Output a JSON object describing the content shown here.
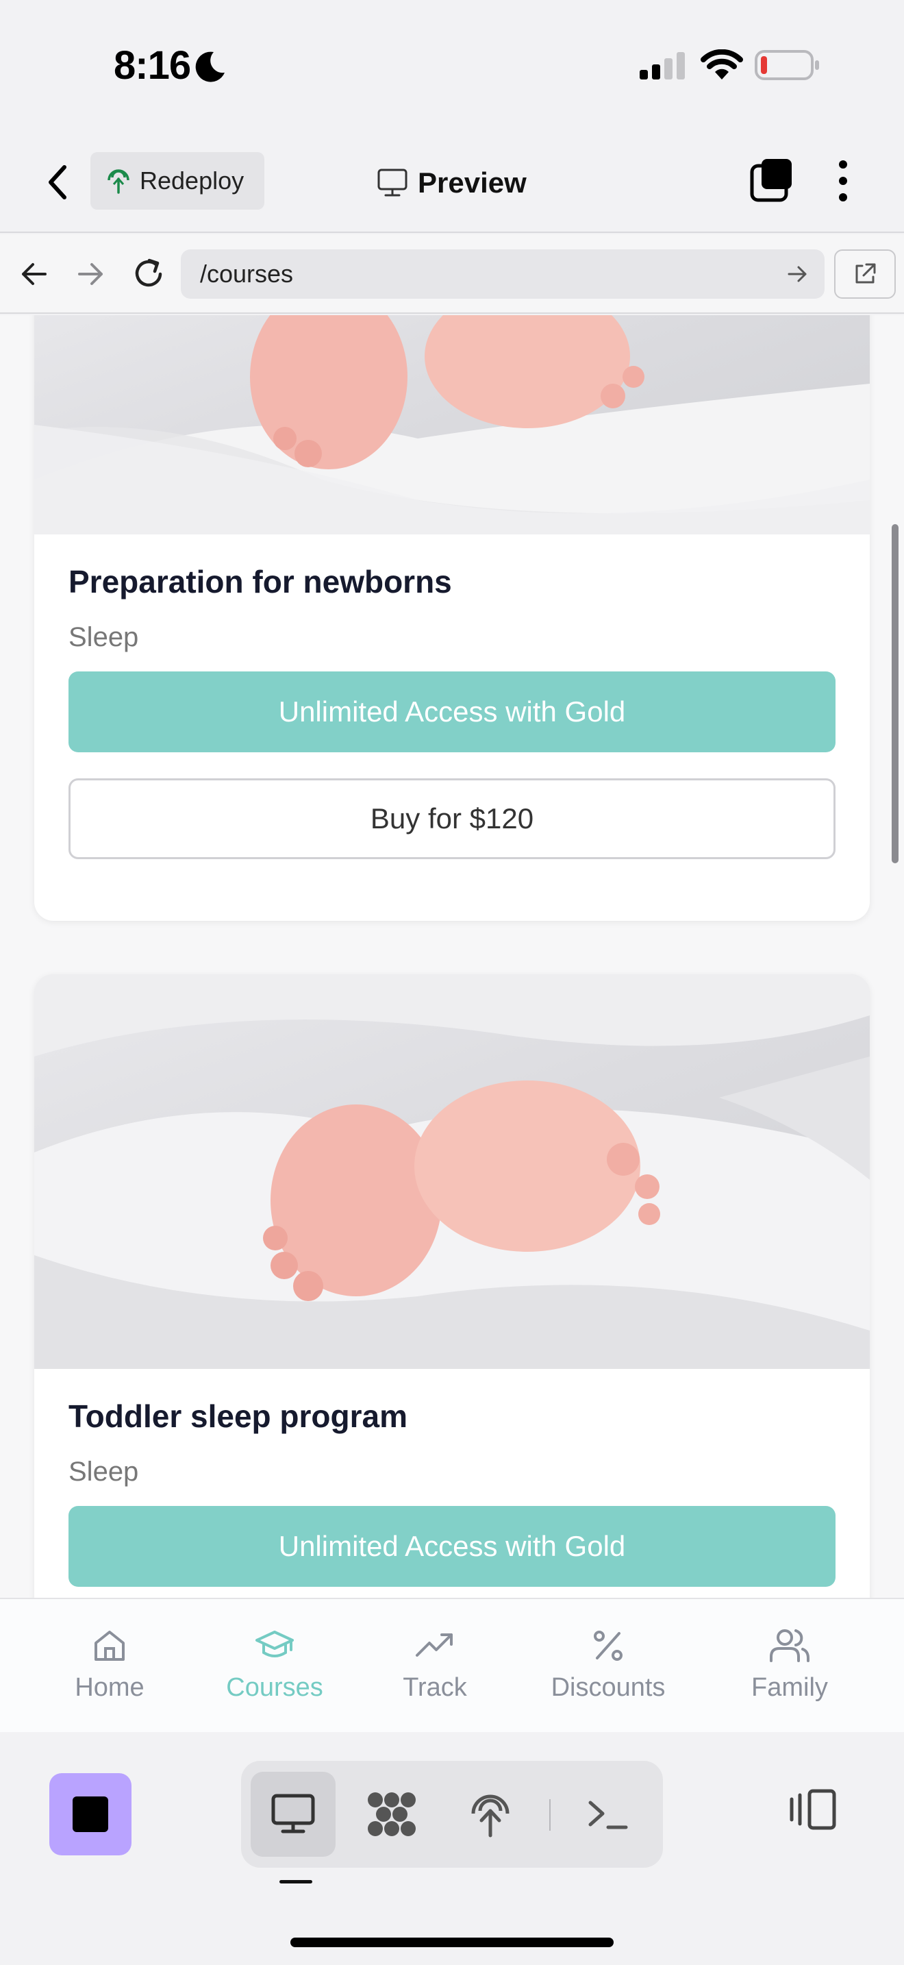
{
  "status_bar": {
    "time": "8:16"
  },
  "header": {
    "redeploy_label": "Redeploy",
    "preview_label": "Preview"
  },
  "browser": {
    "url": "/courses"
  },
  "courses": [
    {
      "title": "Preparation for newborns",
      "category": "Sleep",
      "gold_label": "Unlimited Access with Gold",
      "buy_label": "Buy for $120"
    },
    {
      "title": "Toddler sleep program",
      "category": "Sleep",
      "gold_label": "Unlimited Access with Gold"
    }
  ],
  "bottom_nav": {
    "items": [
      {
        "label": "Home",
        "icon": "home-icon"
      },
      {
        "label": "Courses",
        "icon": "graduation-cap-icon",
        "active": true
      },
      {
        "label": "Track",
        "icon": "trending-up-icon"
      },
      {
        "label": "Discounts",
        "icon": "percent-icon"
      },
      {
        "label": "Family",
        "icon": "users-icon"
      }
    ]
  },
  "colors": {
    "accent": "#82d0c8",
    "nav_active": "#74cbc3",
    "stop_button": "#b9a3ff"
  }
}
